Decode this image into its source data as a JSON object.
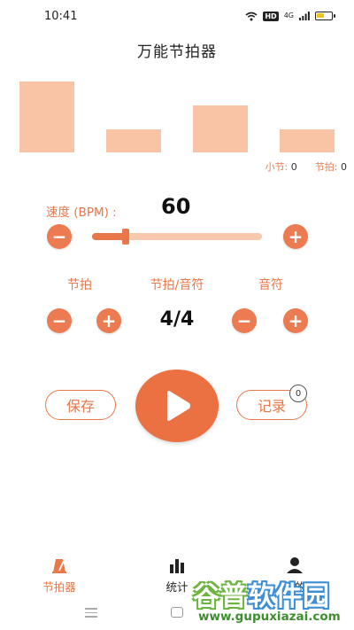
{
  "status_bar": {
    "time": "10:41",
    "hd": "HD",
    "signal": "4G",
    "battery_level": 0.55
  },
  "title": "万能节拍器",
  "beat_bars": [
    {
      "level": 1.0,
      "active": false
    },
    {
      "level": 0.33,
      "active": false
    },
    {
      "level": 0.66,
      "active": false
    },
    {
      "level": 0.33,
      "active": false
    }
  ],
  "counters": {
    "measure_label": "小节:",
    "measure_value": "0",
    "beat_label": "节拍:",
    "beat_value": "0"
  },
  "speed": {
    "label": "速度 (BPM) :",
    "value": "60",
    "slider_fraction": 0.2
  },
  "sections": {
    "beat_label": "节拍",
    "time_sig_label": "节拍/音符",
    "note_label": "音符"
  },
  "time_signature": "4/4",
  "actions": {
    "save_label": "保存",
    "record_label": "记录",
    "record_count": "0"
  },
  "nav": {
    "items": [
      {
        "label": "节拍器",
        "icon": "metronome-icon",
        "active": true
      },
      {
        "label": "统计",
        "icon": "bar-chart-icon",
        "active": false
      },
      {
        "label": "我的",
        "icon": "person-icon",
        "active": false
      }
    ]
  },
  "watermark": {
    "name_part1": "谷普",
    "name_part2": "软件园",
    "url": "www.gupuxiazai.com"
  },
  "colors": {
    "accent": "#e8774a",
    "bar": "#f9c4a6",
    "play": "#ec7142"
  }
}
